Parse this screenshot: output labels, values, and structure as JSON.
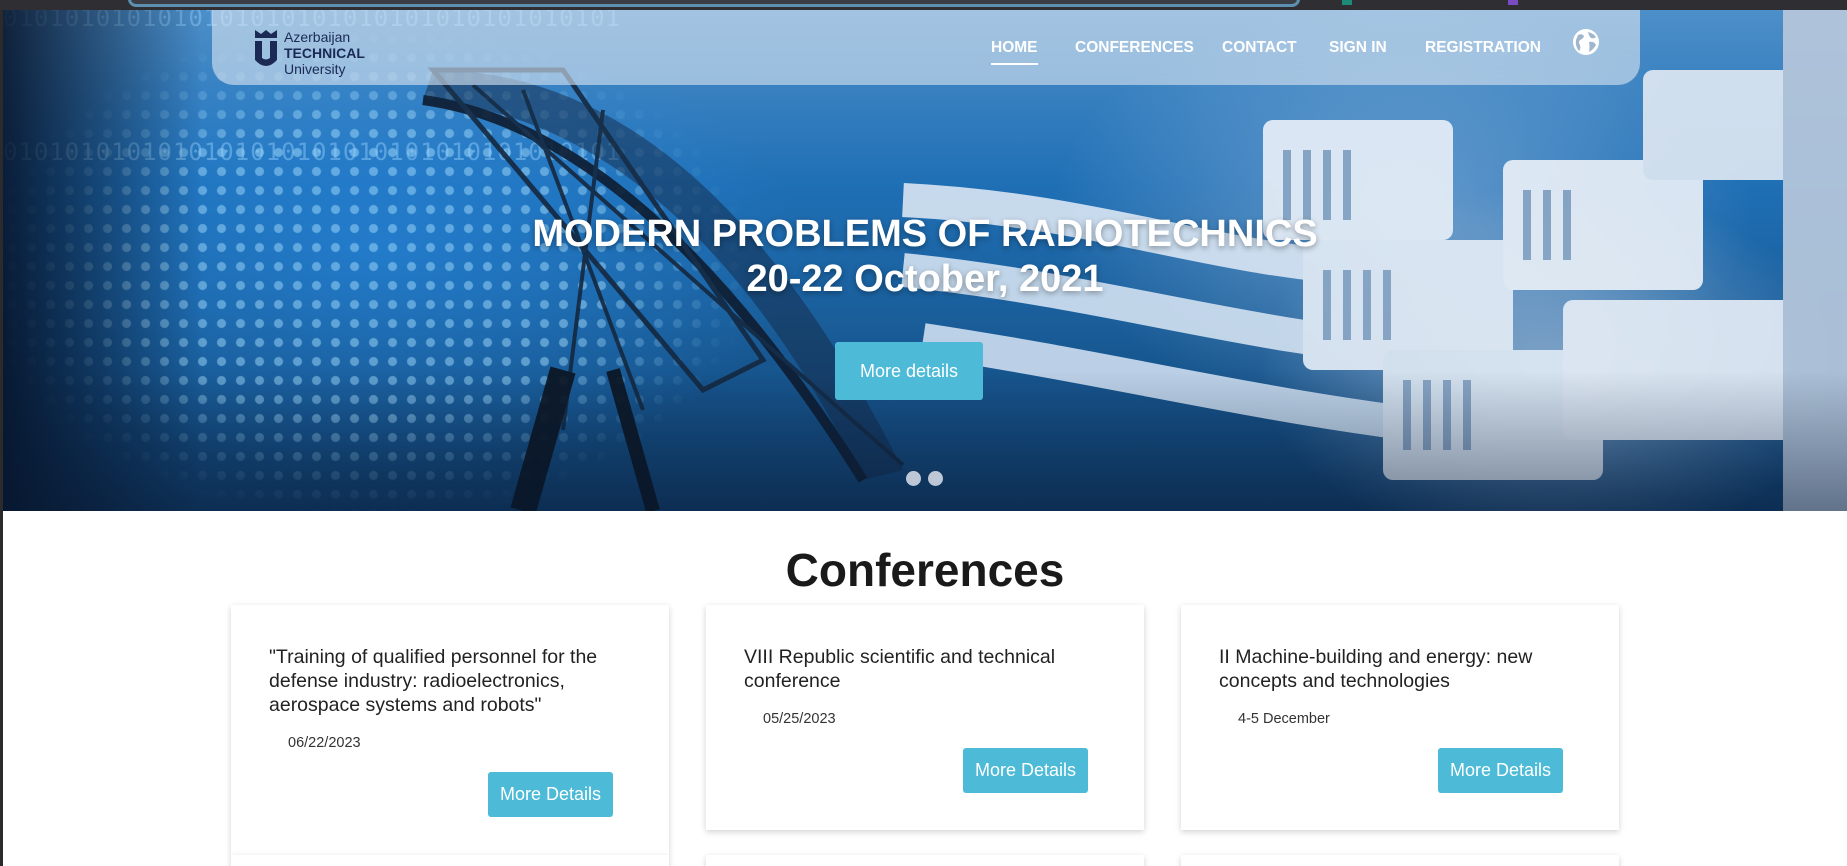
{
  "header": {
    "logo": {
      "line1": "Azerbaijan",
      "line2": "TECHNICAL",
      "line3": "University"
    },
    "nav": [
      {
        "label": "HOME",
        "active": true
      },
      {
        "label": "CONFERENCES",
        "active": false
      },
      {
        "label": "CONTACT",
        "active": false
      },
      {
        "label": "SIGN IN",
        "active": false
      },
      {
        "label": "REGISTRATION",
        "active": false
      }
    ],
    "language_icon": "globe-icon"
  },
  "hero": {
    "title": "MODERN PROBLEMS OF RADIOTECHNICS",
    "date": "20-22 October, 2021",
    "button_label": "More details",
    "background_binary": "0101010101010101010101010101010101010101",
    "slide_count": 2
  },
  "conferences": {
    "heading": "Conferences",
    "cards": [
      {
        "title": "\"Training of qualified personnel for the defense industry: radioelectronics, aerospace systems and robots\"",
        "date": "06/22/2023",
        "button_label": "More Details"
      },
      {
        "title": "VIII Republic scientific and technical conference",
        "date": "05/25/2023",
        "button_label": "More Details"
      },
      {
        "title": "II Machine-building and energy: new concepts and technologies",
        "date": "4-5 December",
        "button_label": "More Details"
      }
    ]
  },
  "colors": {
    "accent": "#4dbad7",
    "logo_navy": "#1b2a55",
    "heading": "#1a1a1a"
  }
}
